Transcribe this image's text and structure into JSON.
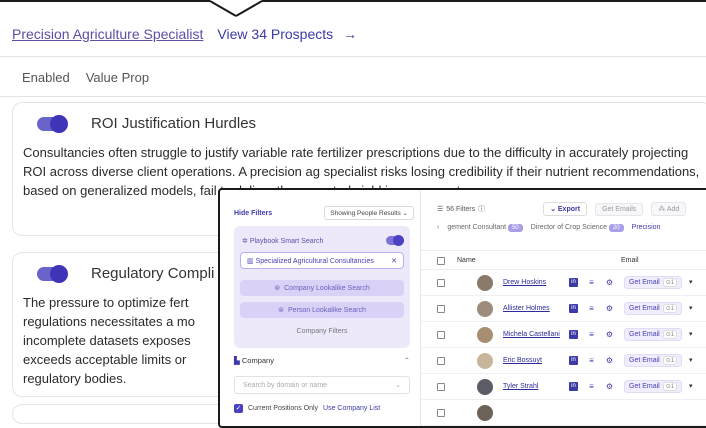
{
  "persona": {
    "title": "Precision Agriculture Specialist",
    "view_prospects": "View 34 Prospects",
    "arrow": "→"
  },
  "columns": {
    "enabled": "Enabled",
    "value_prop": "Value Prop"
  },
  "cards": [
    {
      "title": "ROI Justification Hurdles",
      "body": "Consultancies often struggle to justify variable rate fertilizer prescriptions due to the difficulty in accurately projecting ROI across diverse client operations. A precision ag specialist risks losing credibility if their nutrient recommendations, based on generalized models, fail to deliver the expected yield improvements",
      "enabled": true
    },
    {
      "title": "Regulatory Compli",
      "body": "The pressure to optimize fert regulations necessitates a mo incomplete datasets exposes exceeds acceptable limits or regulatory bodies.",
      "enabled": true
    }
  ],
  "panel": {
    "hide_filters": "Hide Filters",
    "showing": "Showing People Results",
    "smart_search": "Playbook Smart Search",
    "chip_label": "Specialized Agricultural Consultancies",
    "company_lookalike": "Company Lookalike Search",
    "person_lookalike": "Person Lookalike Search",
    "company_filters": "Company Filters",
    "company_label": "Company",
    "domain_placeholder": "Search by domain or name",
    "current_positions": "Current Positions Only",
    "use_company_list": "Use Company List",
    "filters_count": "56 Filters",
    "export": "Export",
    "get_emails": "Get Emails",
    "add": "Add",
    "tab_prev": "gement Consultant",
    "tab_prev_count": "50",
    "tab_director": "Director of Crop Science",
    "tab_director_count": "20",
    "tab_active": "Precision",
    "col_name": "Name",
    "col_email": "Email",
    "get_email": "Get Email",
    "credit": "1",
    "people": [
      "Drew Hoskins",
      "Allister Holmes",
      "Michela Castellani",
      "Eric Bossuyt",
      "Tyler Strahl"
    ]
  },
  "colors": {
    "accent": "#3d34b8",
    "toggle_track": "#6a63c9",
    "link": "#5b4fa6"
  }
}
